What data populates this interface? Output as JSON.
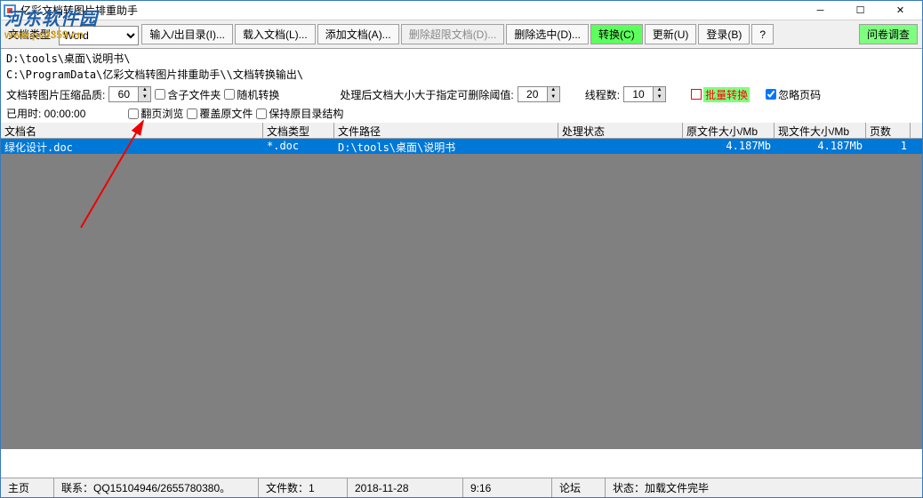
{
  "titlebar": {
    "app_title": "亿彩文档转图片排重助手"
  },
  "watermark": {
    "text": "河东软件园",
    "url": "www.pc0359.cn"
  },
  "toolbar": {
    "doc_type_label": "文档类型:",
    "doc_type_value": "Word",
    "io_dir": "输入/出目录(I)...",
    "load_doc": "载入文档(L)...",
    "add_doc": "添加文档(A)...",
    "del_over": "删除超限文档(D)...",
    "del_sel": "删除选中(D)...",
    "convert": "转换(C)",
    "update": "更新(U)",
    "login": "登录(B)",
    "help": "?",
    "survey": "问卷调查"
  },
  "info": {
    "path1": "D:\\tools\\桌面\\说明书\\",
    "path2": "C:\\ProgramData\\亿彩文档转图片排重助手\\\\文档转换输出\\",
    "quality_label": "文档转图片压缩品质:",
    "quality_value": "60",
    "elapsed_label": "已用时: ",
    "elapsed_value": "00:00:00",
    "chk_subfolder": "含子文件夹",
    "chk_flip": "翻页浏览",
    "chk_random": "随机转换",
    "chk_overwrite": "覆盖原文件",
    "chk_keepdir": "保持原目录结构",
    "threshold_label": "处理后文档大小大于指定可删除阈值:",
    "threshold_value": "20",
    "threads_label": "线程数:",
    "threads_value": "10",
    "batch_label": "批量转换",
    "ignore_page_label": "忽略页码"
  },
  "table": {
    "headers": [
      "文档名",
      "文档类型",
      "文件路径",
      "处理状态",
      "原文件大小/Mb",
      "现文件大小/Mb",
      "页数"
    ],
    "rows": [
      {
        "name": "绿化设计.doc",
        "type": "*.doc",
        "path": "D:\\tools\\桌面\\说明书",
        "status": "",
        "orig_size": "4.187Mb",
        "cur_size": "4.187Mb",
        "pages": "1"
      }
    ]
  },
  "statusbar": {
    "home": "主页",
    "contact": "联系：QQ15104946/2655780380。",
    "file_count": "文件数：1",
    "date": "2018-11-28",
    "time": "9:16",
    "forum": "论坛",
    "status": "状态：加载文件完毕"
  }
}
